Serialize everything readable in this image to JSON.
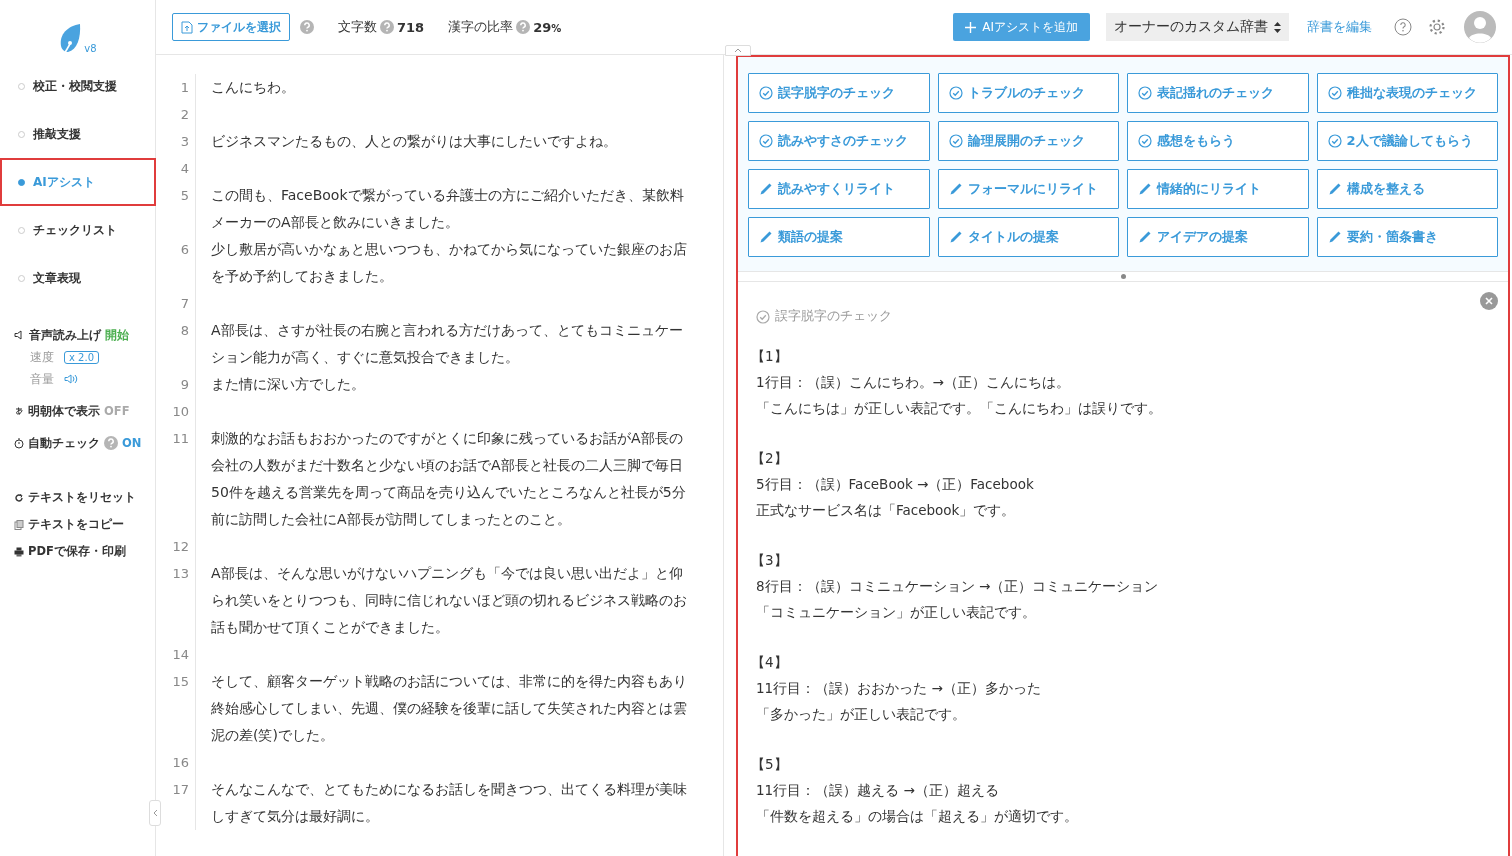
{
  "logo": {
    "version": "v8"
  },
  "sidebar": {
    "nav": [
      {
        "label": "校正・校閲支援",
        "selected": false
      },
      {
        "label": "推敲支援",
        "selected": false
      },
      {
        "label": "AIアシスト",
        "selected": true
      },
      {
        "label": "チェックリスト",
        "selected": false
      },
      {
        "label": "文章表現",
        "selected": false
      }
    ],
    "speech": {
      "label": "音声読み上げ",
      "action": "開始",
      "speed_label": "速度",
      "speed": "x 2.0",
      "volume_label": "音量"
    },
    "mincho": {
      "label": "明朝体で表示",
      "value": "OFF"
    },
    "auto_check": {
      "label": "自動チェック",
      "value": "ON"
    },
    "actions": [
      {
        "kind": "reset",
        "label": "テキストをリセット"
      },
      {
        "kind": "copy",
        "label": "テキストをコピー"
      },
      {
        "kind": "print",
        "label": "PDFで保存・印刷"
      }
    ]
  },
  "toolbar": {
    "file_button": "ファイルを選択",
    "char_count_label": "文字数",
    "char_count": "718",
    "kanji_ratio_label": "漢字の比率",
    "kanji_ratio": "29",
    "kanji_ratio_unit": "%",
    "add_button": "AIアシストを追加",
    "dictionary": "オーナーのカスタム辞書",
    "edit_dictionary": "辞書を編集"
  },
  "editor": {
    "lines": [
      {
        "number": "1",
        "text": "こんにちわ。"
      },
      {
        "number": "2"
      },
      {
        "number": "3",
        "text": "ビジネスマンたるもの、人との繋がりは大事にしたいですよね。"
      },
      {
        "number": "4"
      },
      {
        "number": "5",
        "text": "この間も、FaceBookで繋がっている弁護士の方にご紹介いただき、某飲料メーカーのA部長と飲みにいきました。"
      },
      {
        "number": "6",
        "text": "少し敷居が高いかなぁと思いつつも、かねてから気になっていた銀座のお店を予め予約しておきました。"
      },
      {
        "number": "7"
      },
      {
        "number": "8",
        "text": "A部長は、さすが社長の右腕と言われる方だけあって、とてもコミニュケーション能力が高く、すぐに意気投合できました。"
      },
      {
        "number": "9",
        "text": "また情に深い方でした。"
      },
      {
        "number": "10"
      },
      {
        "number": "11",
        "text": "刺激的なお話もおおかったのですがとくに印象に残っているお話がA部長の会社の人数がまだ十数名と少ない頃のお話でA部長と社長の二人三脚で毎日50件を越える営業先を周って商品を売り込んでいたところなんと社長が5分前に訪問した会社にA部長が訪問してしまったとのこと。"
      },
      {
        "number": "12"
      },
      {
        "number": "13",
        "text": "A部長は、そんな思いがけないハプニングも「今では良い思い出だよ」と仰られ笑いをとりつつも、同時に信じれないほど頭の切れるビジネス戦略のお話も聞かせて頂くことができました。"
      },
      {
        "number": "14"
      },
      {
        "number": "15",
        "text": "そして、顧客ターゲット戦略のお話については、非常に的を得た内容もあり終始感心してしまい、先週、僕の経験を後輩に話して失笑された内容とは雲泥の差(笑)でした。"
      },
      {
        "number": "16"
      },
      {
        "number": "17",
        "text": "そんなこんなで、とてもためになるお話しを聞きつつ、出てくる料理が美味しすぎて気分は最好調に。"
      }
    ]
  },
  "assist": {
    "buttons": [
      {
        "kind": "check",
        "label": "誤字脱字のチェック"
      },
      {
        "kind": "check",
        "label": "トラブルのチェック"
      },
      {
        "kind": "check",
        "label": "表記揺れのチェック"
      },
      {
        "kind": "check",
        "label": "稚拙な表現のチェック"
      },
      {
        "kind": "check",
        "label": "読みやすさのチェック"
      },
      {
        "kind": "check",
        "label": "論理展開のチェック"
      },
      {
        "kind": "check",
        "label": "感想をもらう"
      },
      {
        "kind": "check",
        "label": "2人で議論してもらう"
      },
      {
        "kind": "rewrite",
        "label": "読みやすくリライト"
      },
      {
        "kind": "rewrite",
        "label": "フォーマルにリライト"
      },
      {
        "kind": "rewrite",
        "label": "情緒的にリライト"
      },
      {
        "kind": "rewrite",
        "label": "構成を整える"
      },
      {
        "kind": "rewrite",
        "label": "類語の提案"
      },
      {
        "kind": "rewrite",
        "label": "タイトルの提案"
      },
      {
        "kind": "rewrite",
        "label": "アイデアの提案"
      },
      {
        "kind": "rewrite",
        "label": "要約・箇条書き"
      }
    ],
    "result": {
      "title": "誤字脱字のチェック",
      "items": [
        {
          "number": "【1】",
          "lines": [
            "1行目：（誤）こんにちわ。→（正）こんにちは。",
            "「こんにちは」が正しい表記です。「こんにちわ」は誤りです。"
          ]
        },
        {
          "number": "【2】",
          "lines": [
            "5行目：（誤）FaceBook →（正）Facebook",
            "正式なサービス名は「Facebook」です。"
          ]
        },
        {
          "number": "【3】",
          "lines": [
            "8行目：（誤）コミニュケーション →（正）コミュニケーション",
            "「コミュニケーション」が正しい表記です。"
          ]
        },
        {
          "number": "【4】",
          "lines": [
            "11行目：（誤）おおかった →（正）多かった",
            "「多かった」が正しい表記です。"
          ]
        },
        {
          "number": "【5】",
          "lines": [
            "11行目：（誤）越える →（正）超える",
            "「件数を超える」の場合は「超える」が適切です。"
          ]
        }
      ]
    }
  }
}
